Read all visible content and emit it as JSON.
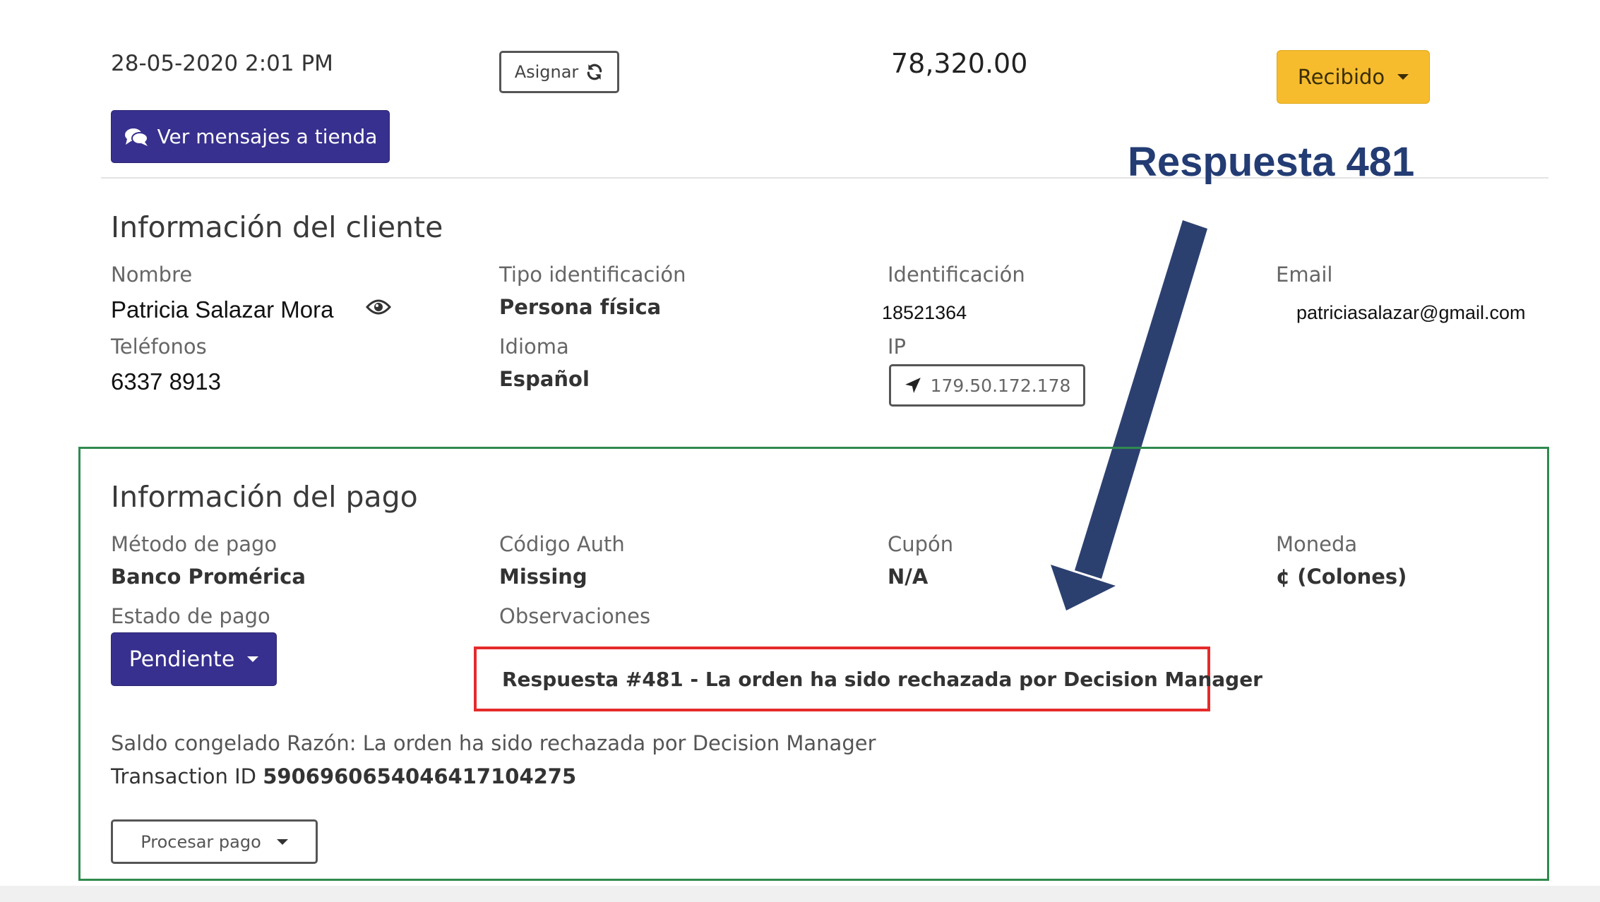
{
  "order": {
    "date": "28-05-2020 2:01 PM",
    "assign_label": "Asignar",
    "amount": "78,320.00",
    "status_label": "Recibido",
    "messages_label": "Ver mensajes a tienda"
  },
  "annotation": {
    "title": "Respuesta 481",
    "arrow_color": "#2c4070"
  },
  "client": {
    "title": "Información del cliente",
    "name_label": "Nombre",
    "name_value": "Patricia Salazar Mora",
    "id_type_label": "Tipo identificación",
    "id_type_value": "Persona física",
    "id_label": "Identificación",
    "id_value": "18521364",
    "email_label": "Email",
    "email_value": "patriciasalazar@gmail.com",
    "phones_label": "Teléfonos",
    "phones_value": "6337 8913",
    "language_label": "Idioma",
    "language_value": "Español",
    "ip_label": "IP",
    "ip_value": "179.50.172.178"
  },
  "payment": {
    "title": "Información del pago",
    "method_label": "Método de pago",
    "method_value": "Banco Promérica",
    "auth_label": "Código Auth",
    "auth_value": "Missing",
    "coupon_label": "Cupón",
    "coupon_value": "N/A",
    "currency_label": "Moneda",
    "currency_value": "¢ (Colones)",
    "status_label": "Estado de pago",
    "status_value": "Pendiente",
    "observations_label": "Observaciones",
    "observation_text": "Respuesta #481 - La orden ha sido rechazada por Decision Manager",
    "frozen_reason": "Saldo congelado Razón: La orden ha sido rechazada por Decision Manager",
    "transaction_label": "Transaction ID",
    "transaction_id": "5906960654046417104275",
    "process_label": "Procesar pago"
  },
  "colors": {
    "primary": "#37308e",
    "warning": "#f6bc2e",
    "panel_border": "#2f8a4e",
    "highlight_border": "#e52b2b"
  }
}
